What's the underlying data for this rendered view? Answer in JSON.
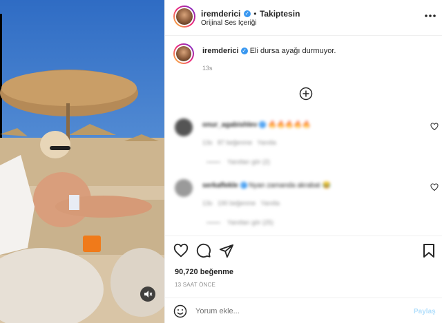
{
  "post": {
    "username": "iremderici",
    "follow_text": "Takiptesin",
    "audio_label": "Orijinal Ses İçeriği",
    "caption": "Eli dursa ayağı durmuyor.",
    "caption_time": "13s",
    "likes": "90,720 beğenme",
    "posted_ago": "13 SAAT ÖNCE"
  },
  "comments": [
    {
      "user": "onur_agabishlev",
      "text": "🔥🔥🔥🔥🔥",
      "time": "13s",
      "likes": "87 beğenme",
      "reply": "Yanıtla",
      "view_replies": "Yanıtları gör (2)"
    },
    {
      "user": "serkaflekle",
      "text": "Nyan zamanda akrabat 😂",
      "time": "13s",
      "likes": "190 beğenme",
      "reply": "Yanıtla",
      "view_replies": "Yanıtları gör (25)"
    }
  ],
  "comment_box": {
    "placeholder": "Yorum ekle...",
    "post_label": "Paylaş"
  },
  "icons": [
    "more-icon",
    "plus-circle-icon",
    "heart-icon",
    "comment-icon",
    "share-icon",
    "bookmark-icon",
    "emoji-icon",
    "mute-icon",
    "verified-icon"
  ],
  "colors": {
    "verified": "#3897f0",
    "post_button_disabled": "#b2dffc"
  }
}
